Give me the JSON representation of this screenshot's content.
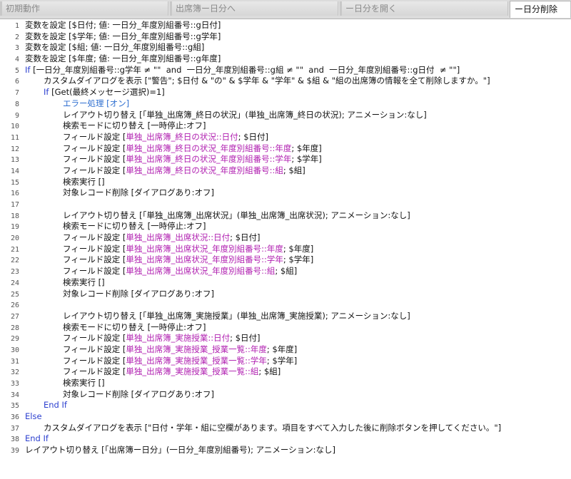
{
  "tabs": [
    {
      "label": "初期動作",
      "active": false
    },
    {
      "label": "出席簿ー日分へ",
      "active": false
    },
    {
      "label": "ー日分を開く",
      "active": false
    },
    {
      "label": "ー日分削除",
      "active": true
    }
  ],
  "colors": {
    "keyword": "#2b3fcf",
    "field": "#b01fb0",
    "text": "#111111",
    "tab_bg": "#dcdcdc"
  },
  "lines": [
    {
      "n": "1",
      "indent": 0,
      "parts": [
        [
          "変数を設定 [$日付; 値: 一日分_年度別組番号::g日付]",
          "t"
        ]
      ]
    },
    {
      "n": "2",
      "indent": 0,
      "parts": [
        [
          "変数を設定 [$学年; 値: 一日分_年度別組番号::g学年]",
          "t"
        ]
      ]
    },
    {
      "n": "3",
      "indent": 0,
      "parts": [
        [
          "変数を設定 [$組; 値: 一日分_年度別組番号::g組]",
          "t"
        ]
      ]
    },
    {
      "n": "4",
      "indent": 0,
      "parts": [
        [
          "変数を設定 [$年度; 値: 一日分_年度別組番号::g年度]",
          "t"
        ]
      ]
    },
    {
      "n": "5",
      "indent": 0,
      "parts": [
        [
          "If",
          "k"
        ],
        [
          " [一日分_年度別組番号::g学年 ≠ \"\"  and  一日分_年度別組番号::g組 ≠ \"\"  and  一日分_年度別組番号::g日付  ≠ \"\"]",
          "t"
        ]
      ]
    },
    {
      "n": "6",
      "indent": 1,
      "parts": [
        [
          "カスタムダイアログを表示 [\"警告\"; $日付 & \"の\" & $学年 & \"学年\" & $組 & \"組の出席簿の情報を全て削除しますか。\"]",
          "t"
        ]
      ]
    },
    {
      "n": "7",
      "indent": 1,
      "parts": [
        [
          "If",
          "k"
        ],
        [
          " [Get(最終メッセージ選択)=1]",
          "t"
        ]
      ]
    },
    {
      "n": "8",
      "indent": 2,
      "parts": [
        [
          "エラー処理 [オン]",
          "c"
        ]
      ]
    },
    {
      "n": "9",
      "indent": 2,
      "parts": [
        [
          "レイアウト切り替え [「単独_出席簿_終日の状況」(単独_出席簿_終日の状況); アニメーション:なし]",
          "t"
        ]
      ]
    },
    {
      "n": "10",
      "indent": 2,
      "parts": [
        [
          "検索モードに切り替え [一時停止:オフ]",
          "t"
        ]
      ]
    },
    {
      "n": "11",
      "indent": 2,
      "parts": [
        [
          "フィールド設定 [",
          "t"
        ],
        [
          "単独_出席簿_終日の状況::日付",
          "f"
        ],
        [
          "; $日付]",
          "t"
        ]
      ]
    },
    {
      "n": "12",
      "indent": 2,
      "parts": [
        [
          "フィールド設定 [",
          "t"
        ],
        [
          "単独_出席簿_終日の状況_年度別組番号::年度",
          "f"
        ],
        [
          "; $年度]",
          "t"
        ]
      ]
    },
    {
      "n": "13",
      "indent": 2,
      "parts": [
        [
          "フィールド設定 [",
          "t"
        ],
        [
          "単独_出席簿_終日の状況_年度別組番号::学年",
          "f"
        ],
        [
          "; $学年]",
          "t"
        ]
      ]
    },
    {
      "n": "14",
      "indent": 2,
      "parts": [
        [
          "フィールド設定 [",
          "t"
        ],
        [
          "単独_出席簿_終日の状況_年度別組番号::組",
          "f"
        ],
        [
          "; $組]",
          "t"
        ]
      ]
    },
    {
      "n": "15",
      "indent": 2,
      "parts": [
        [
          "検索実行 []",
          "t"
        ]
      ]
    },
    {
      "n": "16",
      "indent": 2,
      "parts": [
        [
          "対象レコード削除 [ダイアログあり:オフ]",
          "t"
        ]
      ]
    },
    {
      "n": "17",
      "indent": 2,
      "parts": []
    },
    {
      "n": "18",
      "indent": 2,
      "parts": [
        [
          "レイアウト切り替え [「単独_出席簿_出席状況」(単独_出席簿_出席状況); アニメーション:なし]",
          "t"
        ]
      ]
    },
    {
      "n": "19",
      "indent": 2,
      "parts": [
        [
          "検索モードに切り替え [一時停止:オフ]",
          "t"
        ]
      ]
    },
    {
      "n": "20",
      "indent": 2,
      "parts": [
        [
          "フィールド設定 [",
          "t"
        ],
        [
          "単独_出席簿_出席状況::日付",
          "f"
        ],
        [
          "; $日付]",
          "t"
        ]
      ]
    },
    {
      "n": "21",
      "indent": 2,
      "parts": [
        [
          "フィールド設定 [",
          "t"
        ],
        [
          "単独_出席簿_出席状況_年度別組番号::年度",
          "f"
        ],
        [
          "; $年度]",
          "t"
        ]
      ]
    },
    {
      "n": "22",
      "indent": 2,
      "parts": [
        [
          "フィールド設定 [",
          "t"
        ],
        [
          "単独_出席簿_出席状況_年度別組番号::学年",
          "f"
        ],
        [
          "; $学年]",
          "t"
        ]
      ]
    },
    {
      "n": "23",
      "indent": 2,
      "parts": [
        [
          "フィールド設定 [",
          "t"
        ],
        [
          "単独_出席簿_出席状況_年度別組番号::組",
          "f"
        ],
        [
          "; $組]",
          "t"
        ]
      ]
    },
    {
      "n": "24",
      "indent": 2,
      "parts": [
        [
          "検索実行 []",
          "t"
        ]
      ]
    },
    {
      "n": "25",
      "indent": 2,
      "parts": [
        [
          "対象レコード削除 [ダイアログあり:オフ]",
          "t"
        ]
      ]
    },
    {
      "n": "26",
      "indent": 2,
      "parts": []
    },
    {
      "n": "27",
      "indent": 2,
      "parts": [
        [
          "レイアウト切り替え [「単独_出席簿_実施授業」(単独_出席簿_実施授業); アニメーション:なし]",
          "t"
        ]
      ]
    },
    {
      "n": "28",
      "indent": 2,
      "parts": [
        [
          "検索モードに切り替え [一時停止:オフ]",
          "t"
        ]
      ]
    },
    {
      "n": "29",
      "indent": 2,
      "parts": [
        [
          "フィールド設定 [",
          "t"
        ],
        [
          "単独_出席簿_実施授業::日付",
          "f"
        ],
        [
          "; $日付]",
          "t"
        ]
      ]
    },
    {
      "n": "30",
      "indent": 2,
      "parts": [
        [
          "フィールド設定 [",
          "t"
        ],
        [
          "単独_出席簿_実施授業_授業一覧::年度",
          "f"
        ],
        [
          "; $年度]",
          "t"
        ]
      ]
    },
    {
      "n": "31",
      "indent": 2,
      "parts": [
        [
          "フィールド設定 [",
          "t"
        ],
        [
          "単独_出席簿_実施授業_授業一覧::学年",
          "f"
        ],
        [
          "; $学年]",
          "t"
        ]
      ]
    },
    {
      "n": "32",
      "indent": 2,
      "parts": [
        [
          "フィールド設定 [",
          "t"
        ],
        [
          "単独_出席簿_実施授業_授業一覧::組",
          "f"
        ],
        [
          "; $組]",
          "t"
        ]
      ]
    },
    {
      "n": "33",
      "indent": 2,
      "parts": [
        [
          "検索実行 []",
          "t"
        ]
      ]
    },
    {
      "n": "34",
      "indent": 2,
      "parts": [
        [
          "対象レコード削除 [ダイアログあり:オフ]",
          "t"
        ]
      ]
    },
    {
      "n": "35",
      "indent": 1,
      "parts": [
        [
          "End If",
          "k"
        ]
      ]
    },
    {
      "n": "36",
      "indent": 0,
      "parts": [
        [
          "Else",
          "k"
        ]
      ]
    },
    {
      "n": "37",
      "indent": 1,
      "parts": [
        [
          "カスタムダイアログを表示 [\"日付・学年・組に空欄があります。項目をすべて入力した後に削除ボタンを押してください。\"]",
          "t"
        ]
      ]
    },
    {
      "n": "38",
      "indent": 0,
      "parts": [
        [
          "End If",
          "k"
        ]
      ]
    },
    {
      "n": "39",
      "indent": 0,
      "parts": [
        [
          "レイアウト切り替え [「出席簿ー日分」(一日分_年度別組番号); アニメーション:なし]",
          "t"
        ]
      ]
    }
  ]
}
